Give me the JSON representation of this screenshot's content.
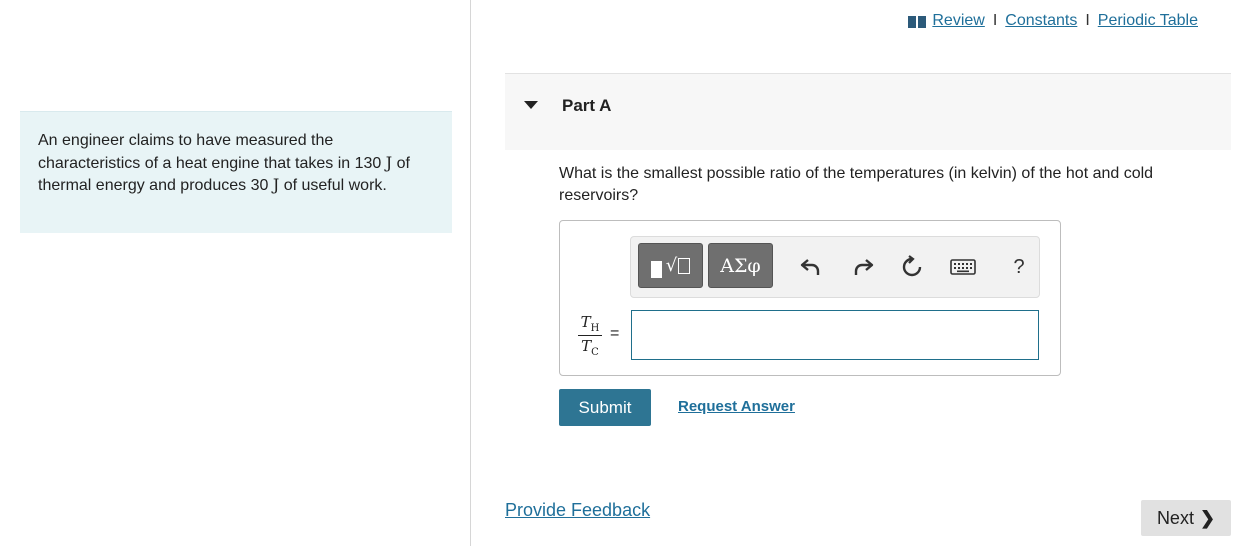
{
  "top_links": {
    "review": "Review",
    "constants": "Constants",
    "periodic_table": "Periodic Table",
    "separator": "I"
  },
  "problem": {
    "text_1": "An engineer claims to have measured the characteristics of a heat engine that takes in ",
    "energy_in_value": "130",
    "unit_1": "J",
    "text_2": " of thermal energy and produces ",
    "work_value": "30",
    "unit_2": "J",
    "text_3": " of useful work."
  },
  "part": {
    "title": "Part A",
    "question": "What is the smallest possible ratio of the temperatures (in kelvin) of the hot and cold reservoirs?"
  },
  "answer": {
    "lhs_numerator": "T",
    "lhs_numerator_sub": "H",
    "lhs_denominator": "T",
    "lhs_denominator_sub": "C",
    "equals": "=",
    "value": "",
    "toolbar": {
      "greek_label": "ΑΣφ",
      "help_label": "?",
      "icons": [
        "templates-icon",
        "greek-icon",
        "undo-icon",
        "redo-icon",
        "reset-icon",
        "keyboard-icon",
        "help-icon"
      ]
    }
  },
  "actions": {
    "submit": "Submit",
    "request_answer": "Request Answer"
  },
  "footer": {
    "provide_feedback": "Provide Feedback",
    "next": "Next"
  },
  "colors": {
    "link": "#1f6f9a",
    "submit_bg": "#2e7593",
    "problem_bg": "#e8f4f6",
    "toolbar_button": "#6f6f6f"
  }
}
